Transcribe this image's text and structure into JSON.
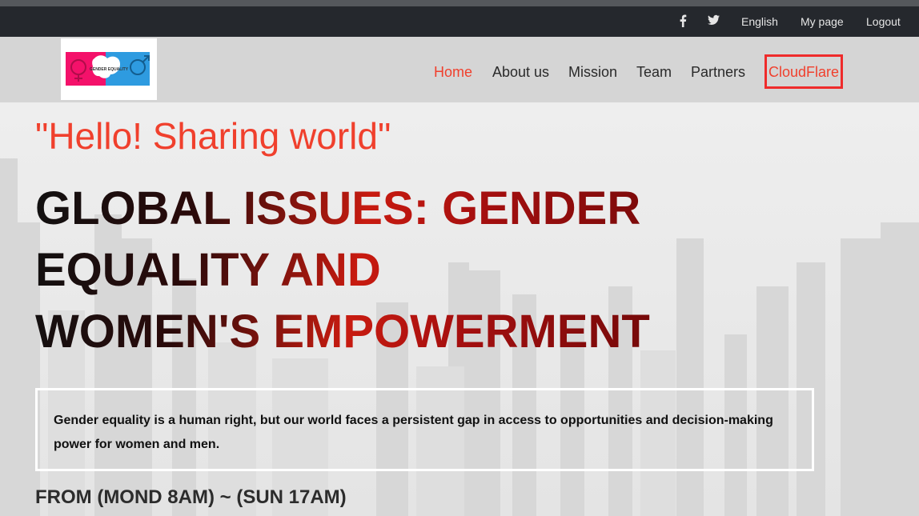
{
  "topbar": {
    "social": [
      {
        "icon": "facebook-icon"
      },
      {
        "icon": "twitter-icon"
      }
    ],
    "language": "English",
    "my_page": "My page",
    "logout": "Logout"
  },
  "header": {
    "logo_text": "GENDER EQUALITY",
    "nav": {
      "home": "Home",
      "about": "About us",
      "mission": "Mission",
      "team": "Team",
      "partners": "Partners",
      "cloudflare": "CloudFlare"
    },
    "active": "home"
  },
  "hero": {
    "greeting": "\"Hello! Sharing world\"",
    "title_lines": [
      "GLOBAL ISSUES: GENDER",
      "EQUALITY AND",
      "WOMEN'S EMPOWERMENT"
    ],
    "description": "Gender equality is a human right, but our world faces a persistent gap in access to opportunities and decision-making power for women and men.",
    "schedule": "FROM (MOND 8AM) ~ (SUN 17AM)"
  },
  "colors": {
    "topbar": "#25282d",
    "header": "#d5d5d5",
    "accent": "#f0402d",
    "highlight_border": "#ef2b2b"
  }
}
